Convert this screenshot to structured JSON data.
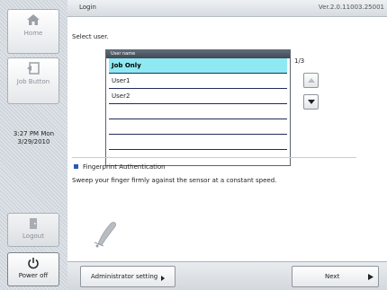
{
  "sidebar": {
    "home_label": "Home",
    "job_button_label": "Job Button",
    "clock_time": "3:27 PM  Mon",
    "clock_date": "3/29/2010",
    "logout_label": "Logout",
    "power_label": "Power off"
  },
  "header": {
    "title": "Login",
    "version": "Ver.2.0.11003.25001"
  },
  "main": {
    "prompt": "Select user.",
    "list": {
      "column_header": "User name",
      "rows": [
        "Job Only",
        "User1",
        "User2",
        "",
        "",
        ""
      ],
      "selected_index": 0
    },
    "page_indicator": "1/3",
    "fingerprint_title": "Fingerprint Authentication",
    "fingerprint_description": "Sweep your finger firmly against the sensor at a constant speed."
  },
  "footer": {
    "admin_label": "Administrator setting",
    "next_label": "Next"
  },
  "colors": {
    "selected_row": "#8fe9f2",
    "list_header": "#4a5561",
    "accent_square": "#2b5ab0"
  },
  "icons": [
    "home-icon",
    "job-button-icon",
    "logout-icon",
    "power-icon",
    "up-arrow-icon",
    "down-arrow-icon",
    "fingerprint-sensor-icon"
  ]
}
